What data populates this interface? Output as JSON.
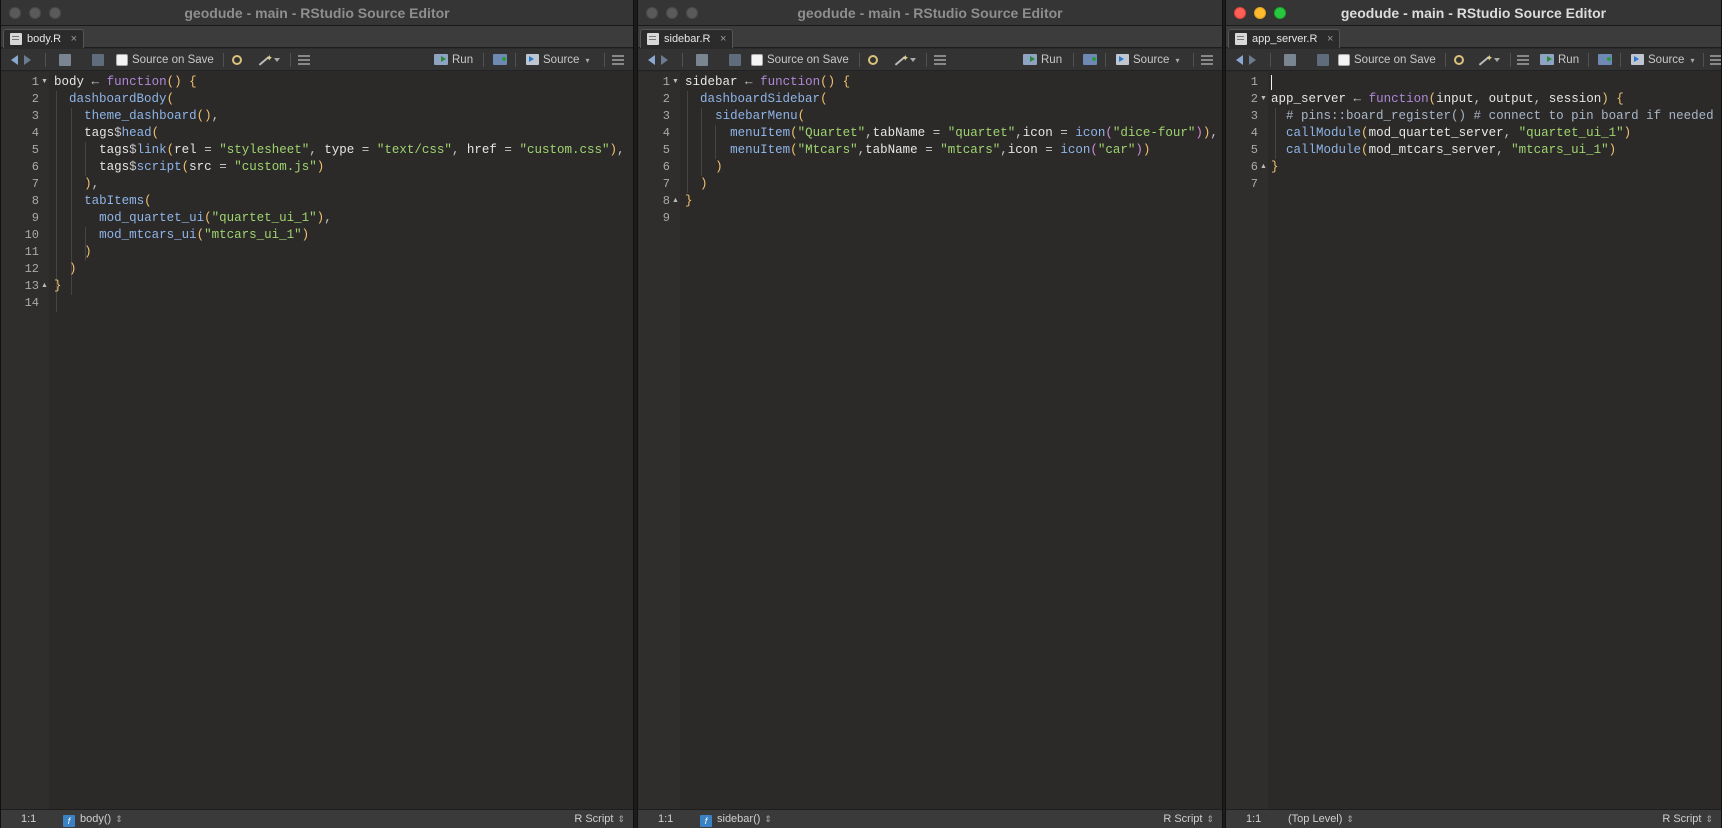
{
  "windows": [
    {
      "title": "geodude - main - RStudio Source Editor",
      "tab": "body.R",
      "toolbar": {
        "source_on_save": "Source on Save",
        "run": "Run",
        "source": "Source"
      },
      "status": {
        "position": "1:1",
        "scope": "body()",
        "filetype": "R Script"
      },
      "line_numbers": [
        "1",
        "2",
        "3",
        "4",
        "5",
        "6",
        "7",
        "8",
        "9",
        "10",
        "11",
        "12",
        "13",
        "14"
      ]
    },
    {
      "title": "geodude - main - RStudio Source Editor",
      "tab": "sidebar.R",
      "toolbar": {
        "source_on_save": "Source on Save",
        "run": "Run",
        "source": "Source"
      },
      "status": {
        "position": "1:1",
        "scope": "sidebar()",
        "filetype": "R Script"
      },
      "line_numbers": [
        "1",
        "2",
        "3",
        "4",
        "5",
        "6",
        "7",
        "8",
        "9"
      ]
    },
    {
      "title": "geodude - main - RStudio Source Editor",
      "tab": "app_server.R",
      "toolbar": {
        "source_on_save": "Source on Save",
        "run": "Run",
        "source": "Source"
      },
      "status": {
        "position": "1:1",
        "scope": "(Top Level)",
        "filetype": "R Script"
      },
      "line_numbers": [
        "1",
        "2",
        "3",
        "4",
        "5",
        "6",
        "7"
      ]
    }
  ],
  "code": {
    "body": [
      "body ← function() {",
      "  dashboardBody(",
      "    theme_dashboard(),",
      "    tags$head(",
      "      tags$link(rel = \"stylesheet\", type = \"text/css\", href = \"custom.css\"),",
      "      tags$script(src = \"custom.js\")",
      "    ),",
      "    tabItems(",
      "      mod_quartet_ui(\"quartet_ui_1\"),",
      "      mod_mtcars_ui(\"mtcars_ui_1\")",
      "    )",
      "  )",
      "}",
      ""
    ],
    "sidebar": [
      "sidebar ← function() {",
      "  dashboardSidebar(",
      "    sidebarMenu(",
      "      menuItem(\"Quartet\",tabName = \"quartet\",icon = icon(\"dice-four\")),",
      "      menuItem(\"Mtcars\",tabName = \"mtcars\",icon = icon(\"car\"))",
      "    )",
      "  )",
      "}",
      ""
    ],
    "app_server": [
      "",
      "app_server ← function(input, output, session) {",
      "  # pins::board_register() # connect to pin board if needed",
      "  callModule(mod_quartet_server, \"quartet_ui_1\")",
      "  callModule(mod_mtcars_server, \"mtcars_ui_1\")",
      "}",
      ""
    ]
  },
  "colors": {
    "editor_bg": "#2b2a29",
    "keyword": "#b088d8",
    "function": "#8fb4e8",
    "string": "#9fd46f",
    "close_red": "#fe5f57",
    "minimize_yellow": "#febc2e",
    "zoom_green": "#28c840"
  },
  "icons": [
    "back-arrow-icon",
    "forward-arrow-icon",
    "show-in-window-icon",
    "save-icon",
    "search-icon",
    "code-tools-wand-icon",
    "compile-report-icon",
    "run-icon",
    "rerun-icon",
    "source-icon",
    "outline-icon",
    "file-r-icon",
    "close-icon",
    "function-icon"
  ]
}
